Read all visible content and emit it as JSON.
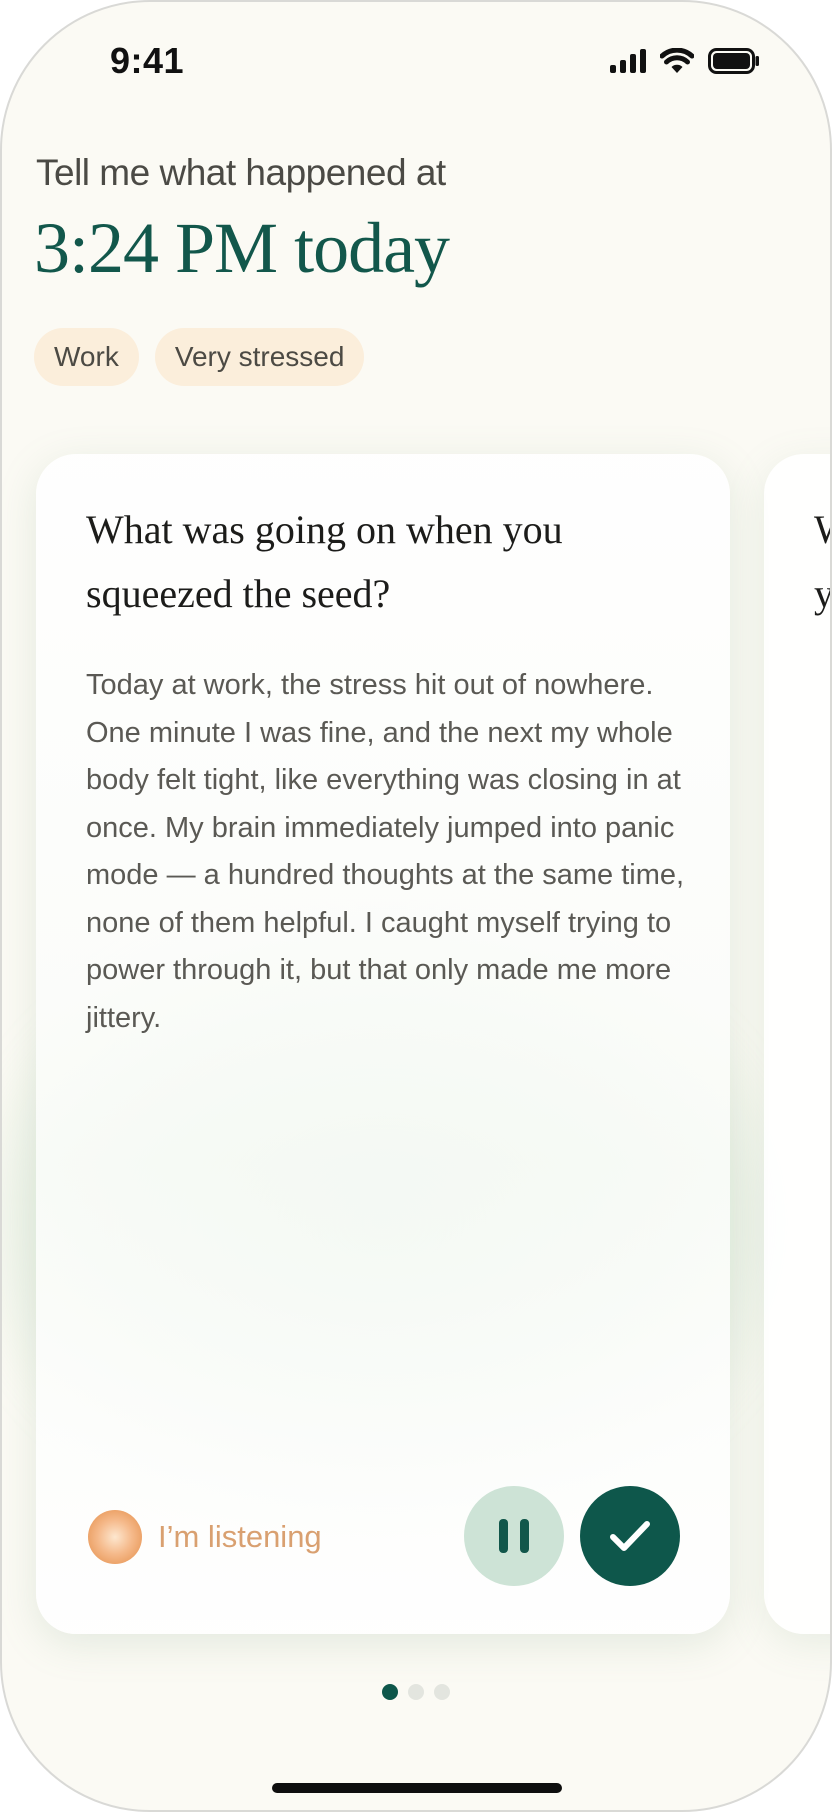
{
  "status_bar": {
    "time": "9:41",
    "icons": [
      "cellular-signal-icon",
      "wifi-icon",
      "battery-icon"
    ]
  },
  "header": {
    "prompt": "Tell me what happened at",
    "time_label": "3:24 PM today"
  },
  "tags": [
    {
      "label": "Work"
    },
    {
      "label": "Very stressed"
    }
  ],
  "card": {
    "question": "What was going on when you squeezed the seed?",
    "answer": "Today at work, the stress hit out of nowhere. One minute I was fine, and the next my whole body felt tight, like everything was closing in at once. My brain immediately jumped into panic mode — a hundred thoughts at the same time, none of them helpful. I caught myself trying to power through it, but that only made me more jittery.",
    "listening_label": "I’m listening",
    "pause_icon": "pause-icon",
    "confirm_icon": "checkmark-icon"
  },
  "next_card": {
    "question_peek": "W\ny"
  },
  "pagination": {
    "total": 3,
    "active_index": 0
  },
  "colors": {
    "background": "#fbfaf4",
    "accent": "#0e574b",
    "tag_bg": "#fbeedb",
    "listening": "#d9a070",
    "pause_bg": "#cde3d6"
  }
}
